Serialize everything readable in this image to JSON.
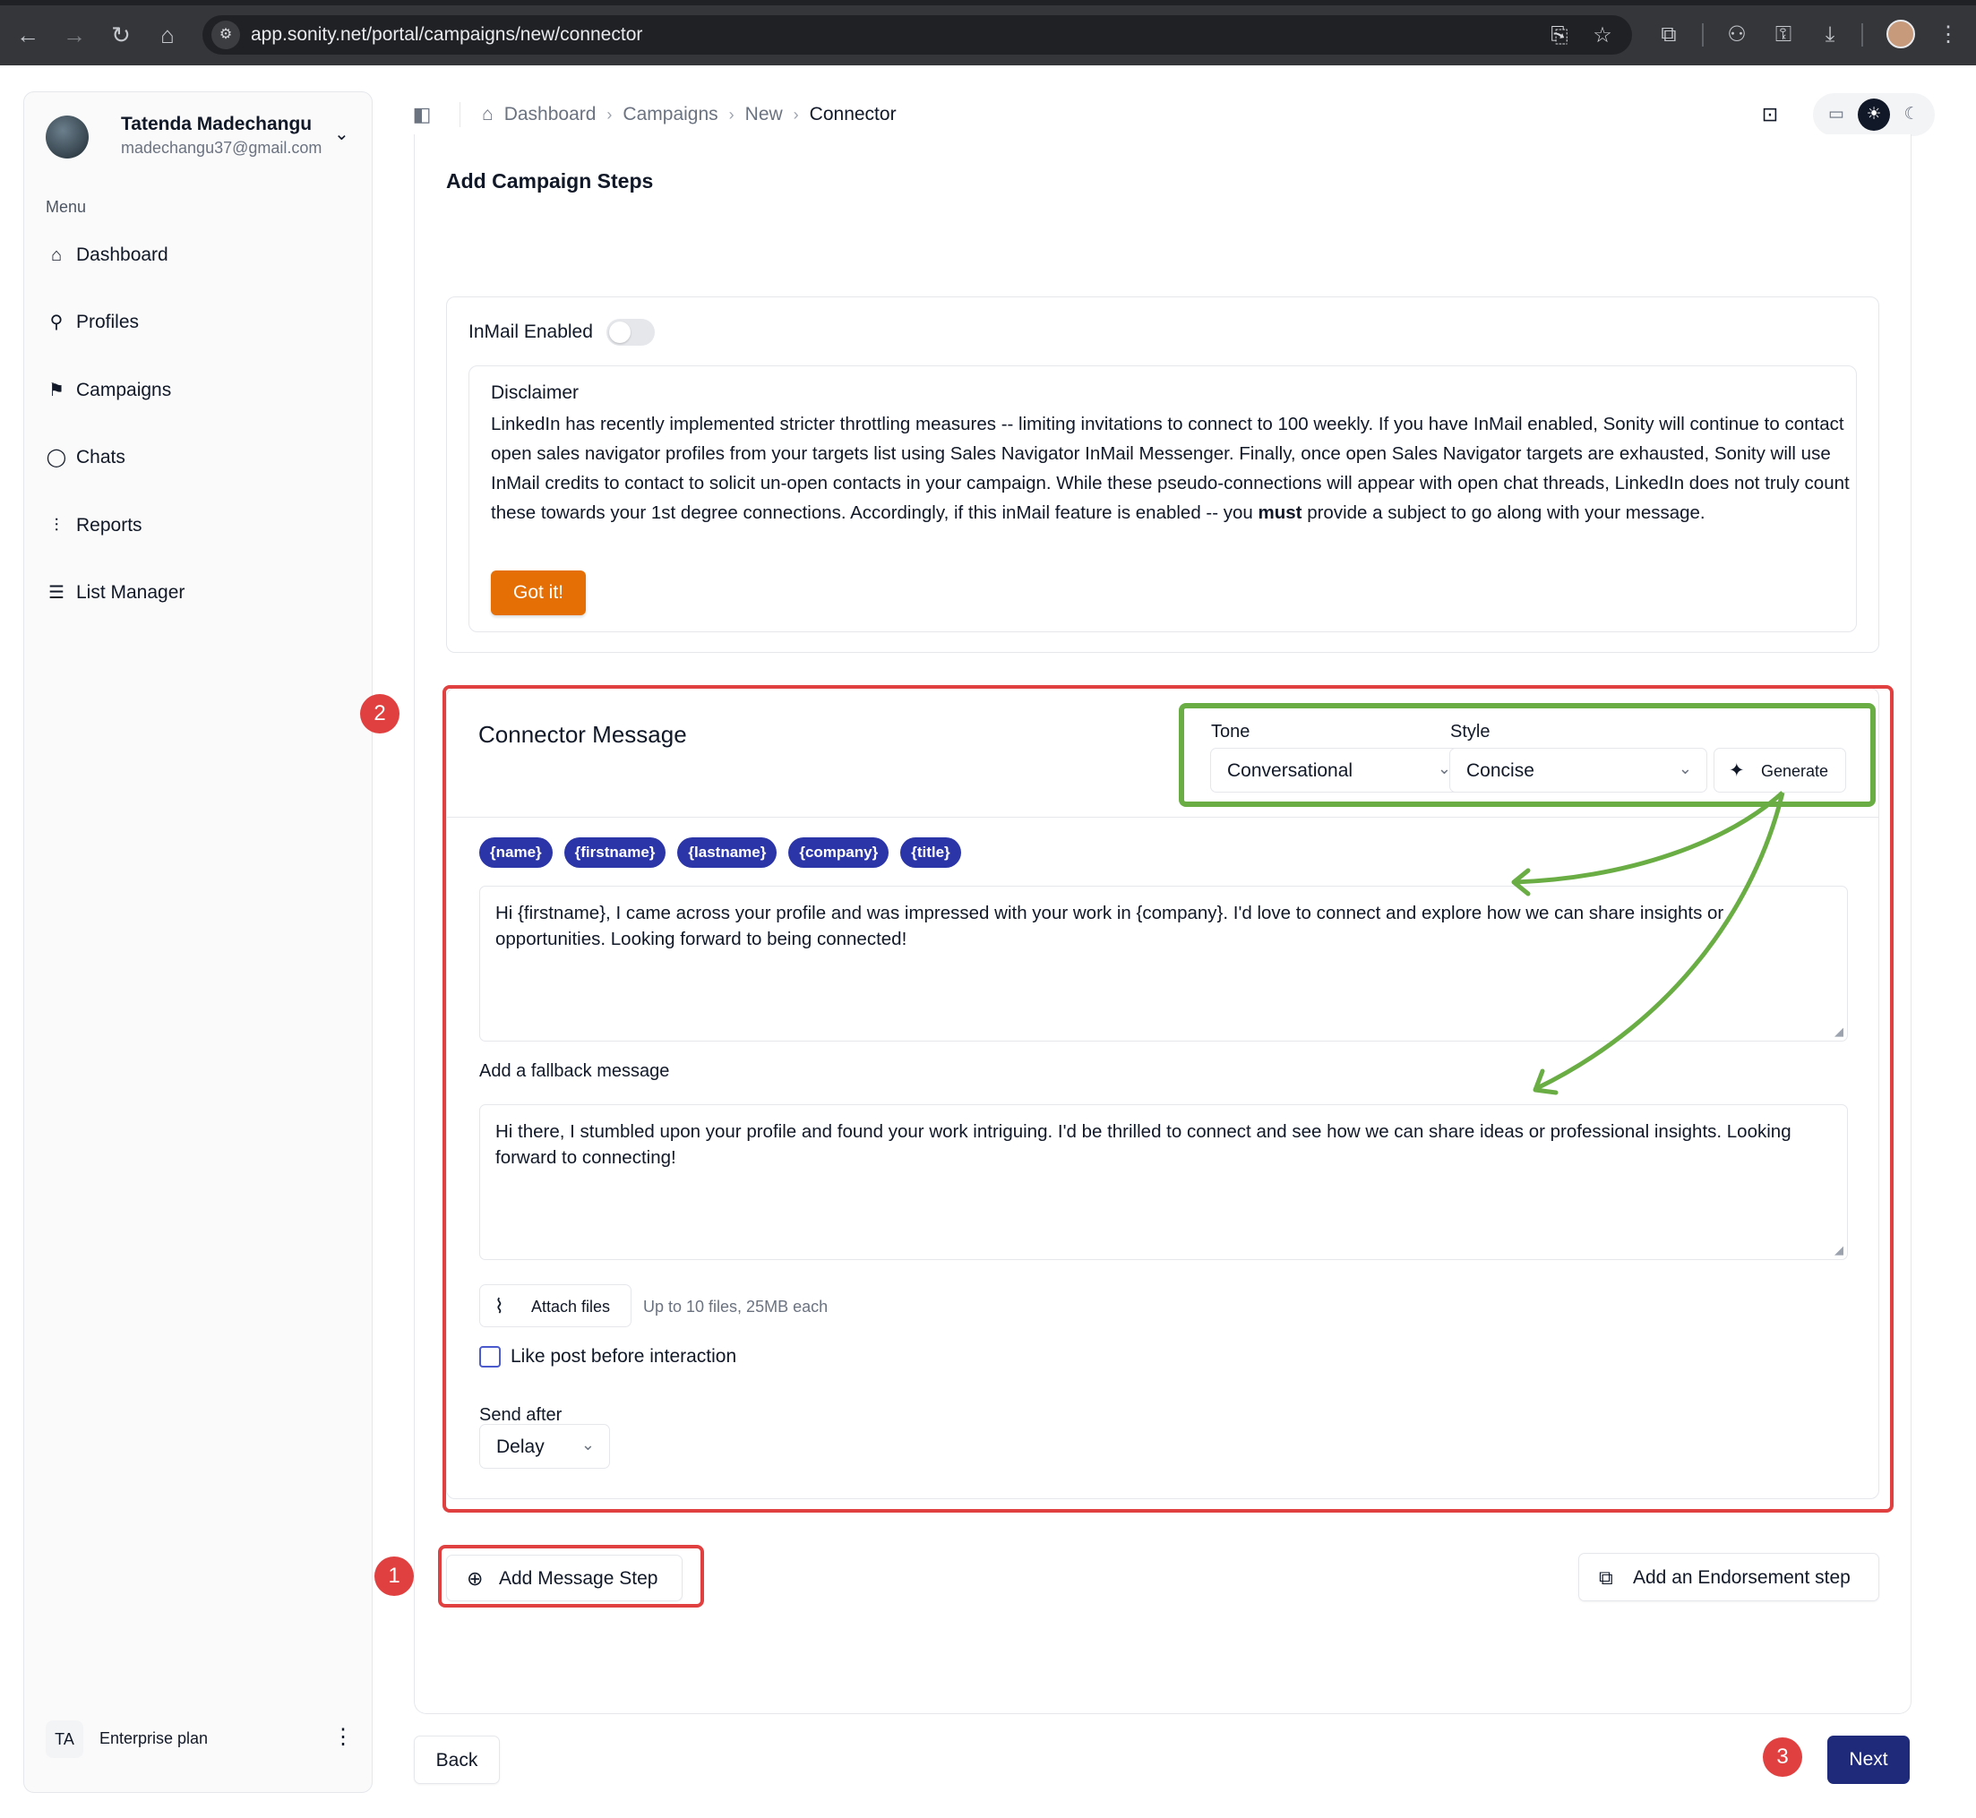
{
  "browser": {
    "url": "app.sonity.net/portal/campaigns/new/connector",
    "icons": [
      "back-icon",
      "forward-icon",
      "reload-icon",
      "home-icon",
      "site-settings-icon",
      "install-app-icon",
      "bookmark-star-icon",
      "extensions-icon",
      "incognito-icon",
      "password-key-icon",
      "download-icon",
      "profile-avatar",
      "more-vert-icon"
    ]
  },
  "sidebar": {
    "user": {
      "name": "Tatenda Madechangu",
      "email": "madechangu37@gmail.com"
    },
    "menu_heading": "Menu",
    "items": [
      {
        "label": "Dashboard",
        "icon": "home-icon"
      },
      {
        "label": "Profiles",
        "icon": "users-icon"
      },
      {
        "label": "Campaigns",
        "icon": "megaphone-icon"
      },
      {
        "label": "Chats",
        "icon": "chat-bubble-icon"
      },
      {
        "label": "Reports",
        "icon": "chart-icon"
      },
      {
        "label": "List Manager",
        "icon": "list-icon"
      }
    ],
    "plan": {
      "badge": "TA",
      "label": "Enterprise plan"
    }
  },
  "header": {
    "breadcrumb": [
      "Dashboard",
      "Campaigns",
      "New",
      "Connector"
    ],
    "theme_mode": "light"
  },
  "main": {
    "section_title": "Add Campaign Steps",
    "inmail": {
      "label": "InMail Enabled",
      "enabled": false,
      "disclaimer_title": "Disclaimer",
      "disclaimer_text_before_bold": "LinkedIn has recently implemented stricter throttling measures -- limiting invitations to connect to 100 weekly. If you have InMail enabled, Sonity will continue to contact open sales navigator profiles from your targets list using Sales Navigator InMail Messenger. Finally, once open Sales Navigator targets are exhausted, Sonity will use InMail credits to contact to solicit un-open contacts in your campaign. While these pseudo-connections will appear with open chat threads, LinkedIn does not truly count these towards your 1st degree connections. Accordingly, if this inMail feature is enabled -- you ",
      "disclaimer_bold": "must",
      "disclaimer_text_after_bold": " provide a subject to go along with your message.",
      "got_it_label": "Got it!",
      "got_it_color": "#e56f04"
    },
    "connector": {
      "title": "Connector Message",
      "tone_label": "Tone",
      "tone_value": "Conversational",
      "style_label": "Style",
      "style_value": "Concise",
      "generate_label": "Generate",
      "variables": [
        "{name}",
        "{firstname}",
        "{lastname}",
        "{company}",
        "{title}"
      ],
      "variable_chip_color": "#2b35a8",
      "message": "Hi {firstname}, I came across your profile and was impressed with your work in {company}. I'd love to connect and explore how we can share insights or opportunities. Looking forward to being connected!",
      "fallback_label": "Add a fallback message",
      "fallback_message": "Hi there, I stumbled upon your profile and found your work intriguing. I'd be thrilled to connect and see how we can share ideas or professional insights. Looking forward to connecting!",
      "attach_label": "Attach files",
      "attach_hint": "Up to 10 files, 25MB each",
      "like_post_label": "Like post before interaction",
      "like_post_checked": false,
      "send_after_label": "Send after",
      "send_after_value": "Delay"
    },
    "add_message_step_label": "Add Message Step",
    "add_endorsement_label": "Add an Endorsement step"
  },
  "footer": {
    "back_label": "Back",
    "next_label": "Next",
    "next_color": "#1f2a7a"
  },
  "annotations": {
    "markers": [
      "1",
      "2",
      "3"
    ],
    "red_color": "#e0403f",
    "green_color": "#6aad45"
  }
}
